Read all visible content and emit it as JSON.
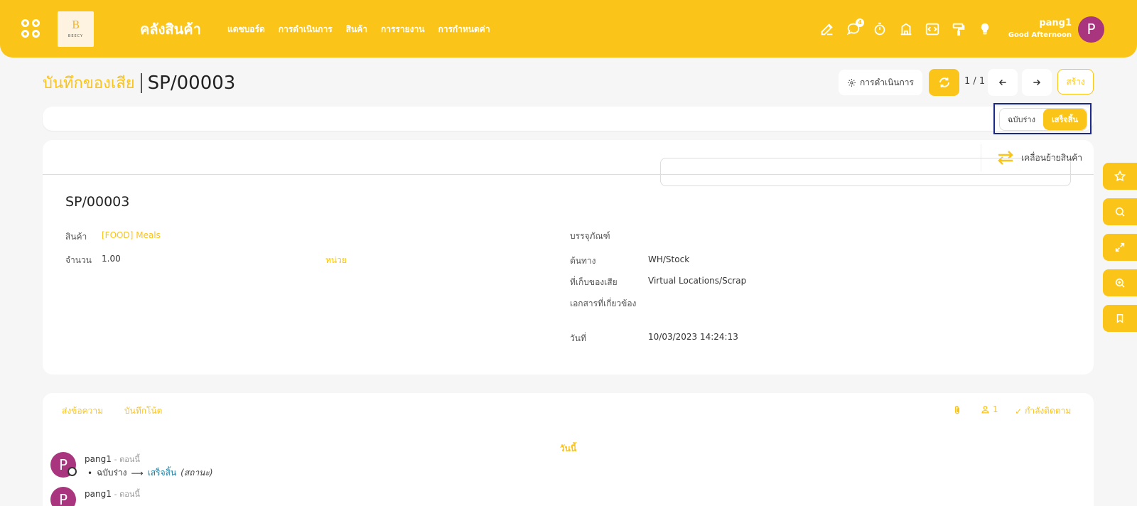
{
  "header": {
    "logo_letter": "B",
    "logo_text": "BEECY",
    "app_title": "คลังสินค้า",
    "nav": [
      "แดชบอร์ด",
      "การดำเนินการ",
      "สินค้า",
      "การรายงาน",
      "การกำหนดค่า"
    ],
    "chat_badge": "4",
    "user_name": "pang1",
    "greeting": "Good Afternoon",
    "avatar_letter": "P",
    "icons": [
      "edit-icon",
      "chat-icon",
      "timer-icon",
      "building-icon",
      "code-icon",
      "paint-roller-icon",
      "lightbulb-icon"
    ]
  },
  "breadcrumb": {
    "parent": "บันทึกของเสีย",
    "current": "SP/00003"
  },
  "toolbar": {
    "actions_label": "การดำเนินการ",
    "pager": "1 / 1",
    "create_label": "สร้าง"
  },
  "status": {
    "draft": "ฉบับร่าง",
    "done": "เสร็จสิ้น",
    "active": "done"
  },
  "form": {
    "smart_button": "เคลื่อนย้ายสินค้า",
    "name": "SP/00003",
    "product_label": "สินค้า",
    "product_value": "[FOOD] Meals",
    "qty_label": "จำนวน",
    "qty_value": "1.00",
    "uom_label": "หน่วย",
    "package_label": "บรรจุภัณฑ์",
    "source_label": "ต้นทาง",
    "source_value": "WH/Stock",
    "scrap_loc_label": "ที่เก็บของเสีย",
    "scrap_loc_value": "Virtual Locations/Scrap",
    "source_doc_label": "เอกสารที่เกี่ยวข้อง",
    "source_doc_value": "",
    "date_label": "วันที่",
    "date_value": "10/03/2023 14:24:13"
  },
  "chatter": {
    "send_message": "ส่งข้อความ",
    "log_note": "บันทึกโน้ต",
    "followers_count": "1",
    "following_label": "กำลังติดตาม",
    "today_label": "วันนี้",
    "messages": [
      {
        "avatar": "P",
        "author": "pang1",
        "time": "- ตอนนี้",
        "old_value": "ฉบับร่าง",
        "new_value": "เสร็จสิ้น",
        "field": "(สถานะ)"
      },
      {
        "avatar": "P",
        "author": "pang1",
        "time": "- ตอนนี้"
      }
    ]
  },
  "side_buttons": [
    "star-icon",
    "search-icon",
    "expand-icon",
    "zoom-in-icon",
    "bookmark-icon"
  ],
  "colors": {
    "accent": "#fbc418",
    "avatar": "#a8357e",
    "highlight_frame": "#1b2a8a"
  }
}
